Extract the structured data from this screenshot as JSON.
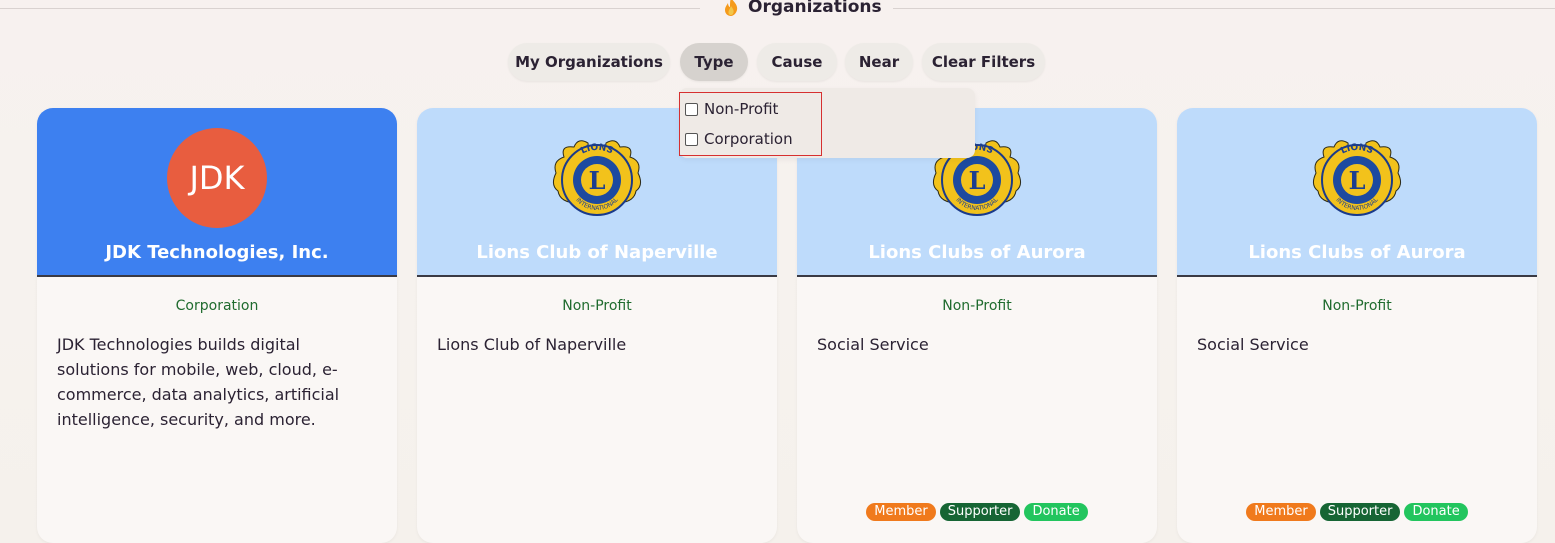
{
  "header": {
    "title": "Organizations",
    "icon": "flame-icon"
  },
  "filters": {
    "my_orgs": "My Organizations",
    "type": "Type",
    "cause": "Cause",
    "near": "Near",
    "clear": "Clear Filters"
  },
  "type_dropdown": {
    "options": [
      {
        "label": "Non-Profit",
        "checked": false
      },
      {
        "label": "Corporation",
        "checked": false
      }
    ]
  },
  "colors": {
    "accent_blue": "#3d80f0",
    "light_blue": "#bedbfb",
    "avatar_orange": "#e85d3f",
    "badge_member": "#f07a1c",
    "badge_supporter": "#166534",
    "badge_donate": "#22c55e",
    "type_green": "#1f6b2e"
  },
  "cards": [
    {
      "name": "JDK Technologies, Inc.",
      "avatar_text": "JDK",
      "type": "Corporation",
      "description": "JDK Technologies builds digital solutions for mobile, web, cloud, e-commerce, data analytics, artificial intelligence, security, and more."
    },
    {
      "name": "Lions Club of Naperville",
      "logo_text": "LIONS",
      "logo_sub": "INTERNATIONAL",
      "logo_letter": "L",
      "type": "Non-Profit",
      "description": "Lions Club of Naperville"
    },
    {
      "name": "Lions Clubs of Aurora",
      "logo_text": "LIONS",
      "logo_sub": "INTERNATIONAL",
      "logo_letter": "L",
      "type": "Non-Profit",
      "description": "Social Service",
      "badges": [
        "Member",
        "Supporter",
        "Donate"
      ]
    },
    {
      "name": "Lions Clubs of Aurora",
      "logo_text": "LIONS",
      "logo_sub": "INTERNATIONAL",
      "logo_letter": "L",
      "type": "Non-Profit",
      "description": "Social Service",
      "badges": [
        "Member",
        "Supporter",
        "Donate"
      ]
    }
  ]
}
